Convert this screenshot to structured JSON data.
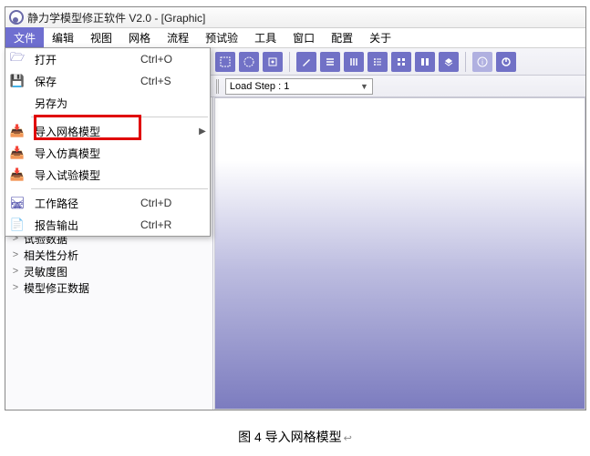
{
  "title": "静力学模型修正软件 V2.0 - [Graphic]",
  "menubar": [
    "文件",
    "编辑",
    "视图",
    "网格",
    "流程",
    "预试验",
    "工具",
    "窗口",
    "配置",
    "关于"
  ],
  "menubar_active": 0,
  "toolbar_icons": [
    "rect-dashed",
    "circle-dashed",
    "fullscreen",
    "sep",
    "pencil",
    "bars-h",
    "bars-v",
    "list",
    "grid4",
    "grid2",
    "layers",
    "sep",
    "info",
    "power"
  ],
  "subbar": {
    "x_label": "×",
    "combo_value": "Load Step : 1"
  },
  "dropdown": [
    {
      "icon": "folder-open",
      "label": "打开",
      "accel": "Ctrl+O"
    },
    {
      "icon": "save",
      "label": "保存",
      "accel": "Ctrl+S"
    },
    {
      "icon": "blank",
      "label": "另存为",
      "accel": ""
    },
    {
      "sep": true
    },
    {
      "icon": "import",
      "label": "导入网格模型",
      "accel": "",
      "submenu": true,
      "highlighted": true
    },
    {
      "icon": "import",
      "label": "导入仿真模型",
      "accel": ""
    },
    {
      "icon": "import",
      "label": "导入试验模型",
      "accel": ""
    },
    {
      "sep": true
    },
    {
      "icon": "path",
      "label": "工作路径",
      "accel": "Ctrl+D"
    },
    {
      "icon": "report",
      "label": "报告输出",
      "accel": "Ctrl+R"
    }
  ],
  "tree": [
    "试验数据",
    "相关性分析",
    "灵敏度图",
    "模型修正数据"
  ],
  "caption": "图 4 导入网格模型",
  "colors": {
    "accent": "#7171c6",
    "highlight": "#e00000"
  }
}
